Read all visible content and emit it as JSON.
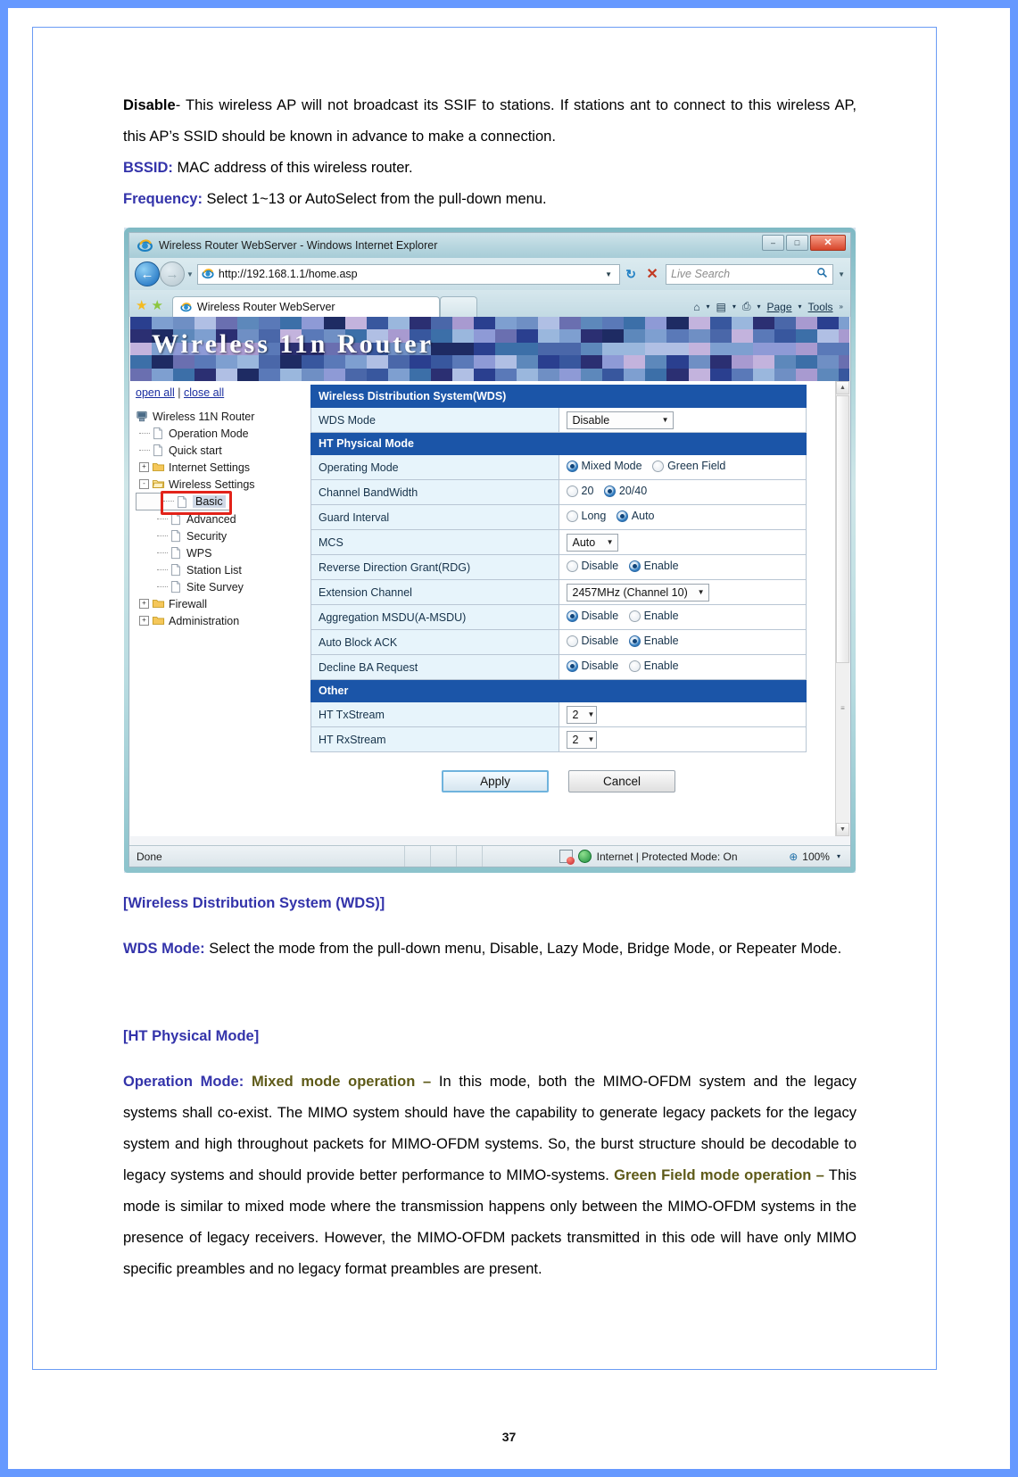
{
  "document": {
    "page_number": "37",
    "paragraphs": {
      "disable_label": "Disable",
      "disable_text": "- This wireless AP will not broadcast its SSIF to stations. If stations ant to connect to this wireless AP, this AP’s SSID should be known in advance to make a connection.",
      "bssid_label": "BSSID:",
      "bssid_text": " MAC address of this wireless router.",
      "frequency_label": "Frequency:",
      "frequency_text": " Select 1~13 or AutoSelect from the pull-down menu.",
      "wds_heading": "[Wireless Distribution System (WDS)]",
      "wds_mode_label": "WDS Mode:",
      "wds_mode_text": " Select the mode from the pull-down menu, Disable, Lazy Mode, Bridge Mode, or Repeater Mode.",
      "ht_heading": "[HT Physical Mode]",
      "operation_mode_label": "Operation Mode:",
      "mixed_mode_label": "Mixed mode operation –",
      "mixed_mode_text": " In this mode, both the MIMO-OFDM system and the legacy systems shall co-exist. The MIMO system should have the capability to generate legacy packets for the legacy system and high throughout packets for MIMO-OFDM systems. So, the burst structure should be decodable to legacy systems and should provide better performance to MIMO-systems.  ",
      "green_field_label": "Green Field mode operation –",
      "green_field_text": " This mode is similar to mixed mode where the transmission happens only between the MIMO-OFDM systems in the presence of legacy receivers. However, the MIMO-OFDM packets transmitted in this ode will have only MIMO specific preambles and no legacy format preambles are present."
    }
  },
  "browser": {
    "window_title": "Wireless Router WebServer - Windows Internet Explorer",
    "minimize_label": "–",
    "maximize_label": "□",
    "close_label": "✕",
    "back_label": "←",
    "forward_label": "→",
    "address_value": "http://192.168.1.1/home.asp",
    "address_caret": "▼",
    "refresh_label": "↻",
    "stop_label": "✕",
    "search_placeholder": "Live Search",
    "search_icon_label": "⚲",
    "search_caret": "▼",
    "fav_star_label": "★",
    "addfav_star_label": "★",
    "tab_title": "Wireless Router WebServer",
    "toolbar": {
      "home_label": "⌂",
      "feeds_label": "▤",
      "print_label": "⎙",
      "page_label": "Page",
      "tools_label": "Tools",
      "chevron_label": "»",
      "caret": "▾"
    },
    "status": {
      "done": "Done",
      "zone": "Internet | Protected Mode: On",
      "zoom": "100%",
      "zoom_caret": "▾",
      "zoom_icon": "⊕"
    },
    "scroll": {
      "up": "▲",
      "down": "▼",
      "grip": "≡"
    }
  },
  "router_ui": {
    "banner_title": "Wireless 11n Router",
    "tree": {
      "open_all": "open all",
      "separator": "|",
      "close_all": "close all",
      "items": [
        {
          "label": "Wireless 11N Router",
          "level": 0,
          "icon": "device-icon",
          "toggle": "",
          "selected": false
        },
        {
          "label": "Operation Mode",
          "level": 1,
          "icon": "page-icon",
          "toggle": "",
          "selected": false
        },
        {
          "label": "Quick start",
          "level": 1,
          "icon": "page-icon",
          "toggle": "",
          "selected": false
        },
        {
          "label": "Internet Settings",
          "level": 1,
          "icon": "folder-icon",
          "toggle": "+",
          "selected": false
        },
        {
          "label": "Wireless Settings",
          "level": 1,
          "icon": "folder-open-icon",
          "toggle": "-",
          "selected": false
        },
        {
          "label": "Basic",
          "level": 2,
          "icon": "page-icon",
          "toggle": "",
          "selected": true
        },
        {
          "label": "Advanced",
          "level": 2,
          "icon": "page-icon",
          "toggle": "",
          "selected": false
        },
        {
          "label": "Security",
          "level": 2,
          "icon": "page-icon",
          "toggle": "",
          "selected": false
        },
        {
          "label": "WPS",
          "level": 2,
          "icon": "page-icon",
          "toggle": "",
          "selected": false
        },
        {
          "label": "Station List",
          "level": 2,
          "icon": "page-icon",
          "toggle": "",
          "selected": false
        },
        {
          "label": "Site Survey",
          "level": 2,
          "icon": "page-icon",
          "toggle": "",
          "selected": false
        },
        {
          "label": "Firewall",
          "level": 1,
          "icon": "folder-icon",
          "toggle": "+",
          "selected": false
        },
        {
          "label": "Administration",
          "level": 1,
          "icon": "folder-icon",
          "toggle": "+",
          "selected": false
        }
      ]
    },
    "sections": {
      "wds": "Wireless Distribution System(WDS)",
      "ht": "HT Physical Mode",
      "other": "Other"
    },
    "rows": {
      "wds_mode": {
        "label": "WDS Mode",
        "value": "Disable"
      },
      "operating_mode": {
        "label": "Operating Mode",
        "opt1": "Mixed Mode",
        "opt2": "Green Field",
        "selected": 1
      },
      "channel_bandwidth": {
        "label": "Channel BandWidth",
        "opt1": "20",
        "opt2": "20/40",
        "selected": 2
      },
      "guard_interval": {
        "label": "Guard Interval",
        "opt1": "Long",
        "opt2": "Auto",
        "selected": 2
      },
      "mcs": {
        "label": "MCS",
        "value": "Auto"
      },
      "rdg": {
        "label": "Reverse Direction Grant(RDG)",
        "opt1": "Disable",
        "opt2": "Enable",
        "selected": 2
      },
      "extension_channel": {
        "label": "Extension Channel",
        "value": "2457MHz (Channel 10)"
      },
      "amsdu": {
        "label": "Aggregation MSDU(A-MSDU)",
        "opt1": "Disable",
        "opt2": "Enable",
        "selected": 1
      },
      "auto_block_ack": {
        "label": "Auto Block ACK",
        "opt1": "Disable",
        "opt2": "Enable",
        "selected": 2
      },
      "decline_ba": {
        "label": "Decline BA Request",
        "opt1": "Disable",
        "opt2": "Enable",
        "selected": 1
      },
      "ht_tx": {
        "label": "HT TxStream",
        "value": "2"
      },
      "ht_rx": {
        "label": "HT RxStream",
        "value": "2"
      }
    },
    "buttons": {
      "apply": "Apply",
      "cancel": "Cancel"
    },
    "select_caret": "▼"
  }
}
